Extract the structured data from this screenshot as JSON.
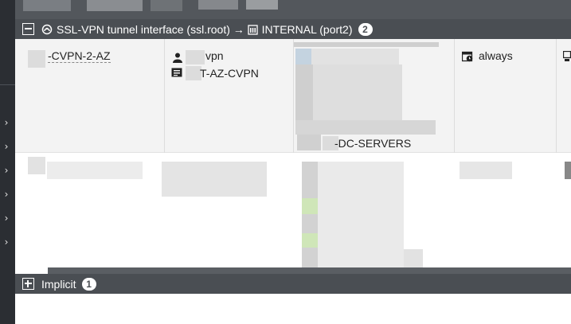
{
  "sidebar": {
    "chevrons": [
      "›",
      "›",
      "›",
      "›",
      "›",
      "›"
    ]
  },
  "sections": {
    "ssl": {
      "title": "SSL-VPN tunnel interface (ssl.root) → ",
      "dest": "INTERNAL (port2)",
      "count": "2",
      "toggle_icon": "collapse-icon"
    },
    "implicit": {
      "title": "Implicit",
      "count": "1",
      "toggle_icon": "expand-icon"
    }
  },
  "policy_row": {
    "name": "-CVPN-2-AZ",
    "source_user": "vpn",
    "source_group": "T-AZ-CVPN",
    "destination": "-DC-SERVERS",
    "schedule": "always"
  },
  "colors": {
    "header_bg": "#4a4e53",
    "nav_bg": "#2b2e33",
    "selected_row_bg": "#f3f3f3"
  }
}
